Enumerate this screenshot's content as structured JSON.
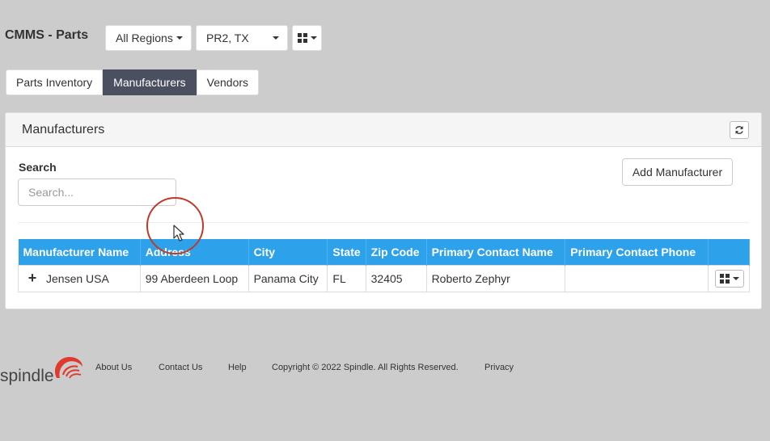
{
  "header": {
    "app_title": "CMMS - Parts",
    "region_label": "All Regions",
    "site_label": "PR2, TX"
  },
  "tabs": [
    {
      "label": "Parts Inventory",
      "active": false
    },
    {
      "label": "Manufacturers",
      "active": true
    },
    {
      "label": "Vendors",
      "active": false
    }
  ],
  "panel": {
    "title": "Manufacturers",
    "search_label": "Search",
    "search_placeholder": "Search...",
    "search_value": "",
    "add_button_label": "Add Manufacturer"
  },
  "table": {
    "columns": [
      "Manufacturer Name",
      "Address",
      "City",
      "State",
      "Zip Code",
      "Primary Contact Name",
      "Primary Contact Phone"
    ],
    "rows": [
      {
        "name": "Jensen USA",
        "address": "99 Aberdeen Loop",
        "city": "Panama City",
        "state": "FL",
        "zip": "32405",
        "contact_name": "Roberto Zephyr",
        "contact_phone": ""
      }
    ]
  },
  "footer": {
    "logo_text": "spindle",
    "links": [
      "About Us",
      "Contact Us",
      "Help"
    ],
    "copyright": "Copyright © 2022 Spindle. All Rights Reserved.",
    "privacy": "Privacy"
  },
  "colors": {
    "page_bg": "#cccccc",
    "table_header": "#2da1ea",
    "active_tab": "#4a5060",
    "logo_red": "#e03a2f"
  }
}
